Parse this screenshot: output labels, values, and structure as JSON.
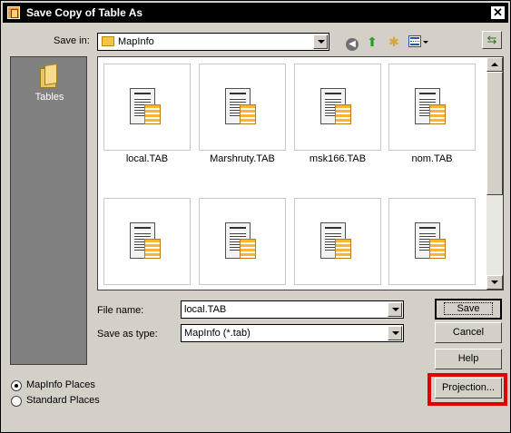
{
  "window": {
    "title": "Save Copy of Table As",
    "close": "✕"
  },
  "toolbar": {
    "save_in_label": "Save in:",
    "save_in_value": "MapInfo",
    "back_icon": "back-icon",
    "up_icon": "up-folder-icon",
    "new_folder_icon": "new-folder-icon",
    "views_icon": "views-menu-icon",
    "right_icon": "tools-icon"
  },
  "places": {
    "items": [
      {
        "label": "Tables",
        "icon": "folder-icon"
      }
    ]
  },
  "files": [
    {
      "name": "local.TAB"
    },
    {
      "name": "Marshruty.TAB"
    },
    {
      "name": "msk166.TAB"
    },
    {
      "name": "nom.TAB"
    },
    {
      "name": ""
    },
    {
      "name": ""
    },
    {
      "name": ""
    },
    {
      "name": ""
    }
  ],
  "form": {
    "file_name_label": "File name:",
    "file_name_value": "local.TAB",
    "type_label": "Save as type:",
    "type_value": "MapInfo (*.tab)"
  },
  "buttons": {
    "save": "Save",
    "cancel": "Cancel",
    "help": "Help",
    "projection": "Projection..."
  },
  "radio": {
    "mapinfo_places": "MapInfo Places",
    "standard_places": "Standard Places"
  },
  "colors": {
    "highlight": "#e00000",
    "places_bg": "#808080"
  }
}
